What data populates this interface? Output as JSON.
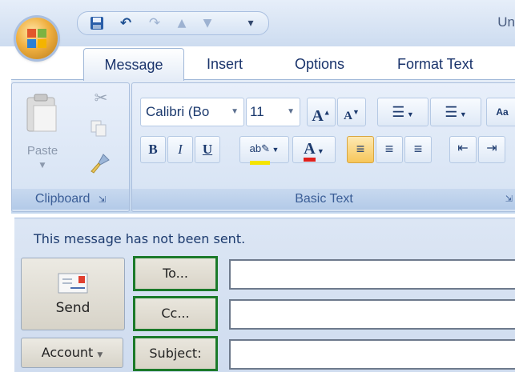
{
  "window": {
    "title": "Un"
  },
  "quick_access": {
    "save_icon": "save-icon",
    "undo_icon": "undo-icon",
    "redo_icon": "redo-icon",
    "up_icon": "previous-item-icon",
    "down_icon": "next-item-icon",
    "customize_icon": "customize-qat-icon"
  },
  "tabs": [
    {
      "label": "Message",
      "active": true
    },
    {
      "label": "Insert"
    },
    {
      "label": "Options"
    },
    {
      "label": "Format Text"
    }
  ],
  "ribbon": {
    "clipboard": {
      "label": "Clipboard",
      "paste_label": "Paste"
    },
    "basic_text": {
      "label": "Basic Text",
      "font_name": "Calibri (Bo",
      "font_size": "11"
    }
  },
  "compose": {
    "info_message": "This message has not been sent.",
    "send_label": "Send",
    "account_label": "Account",
    "to_label": "To...",
    "cc_label": "Cc...",
    "subject_label": "Subject:",
    "to_value": "",
    "cc_value": "",
    "subject_value": ""
  },
  "colors": {
    "field_highlight": "#1b7a2a",
    "ribbon": "#d5e2f3",
    "accent_blue": "#1c3a6e"
  }
}
